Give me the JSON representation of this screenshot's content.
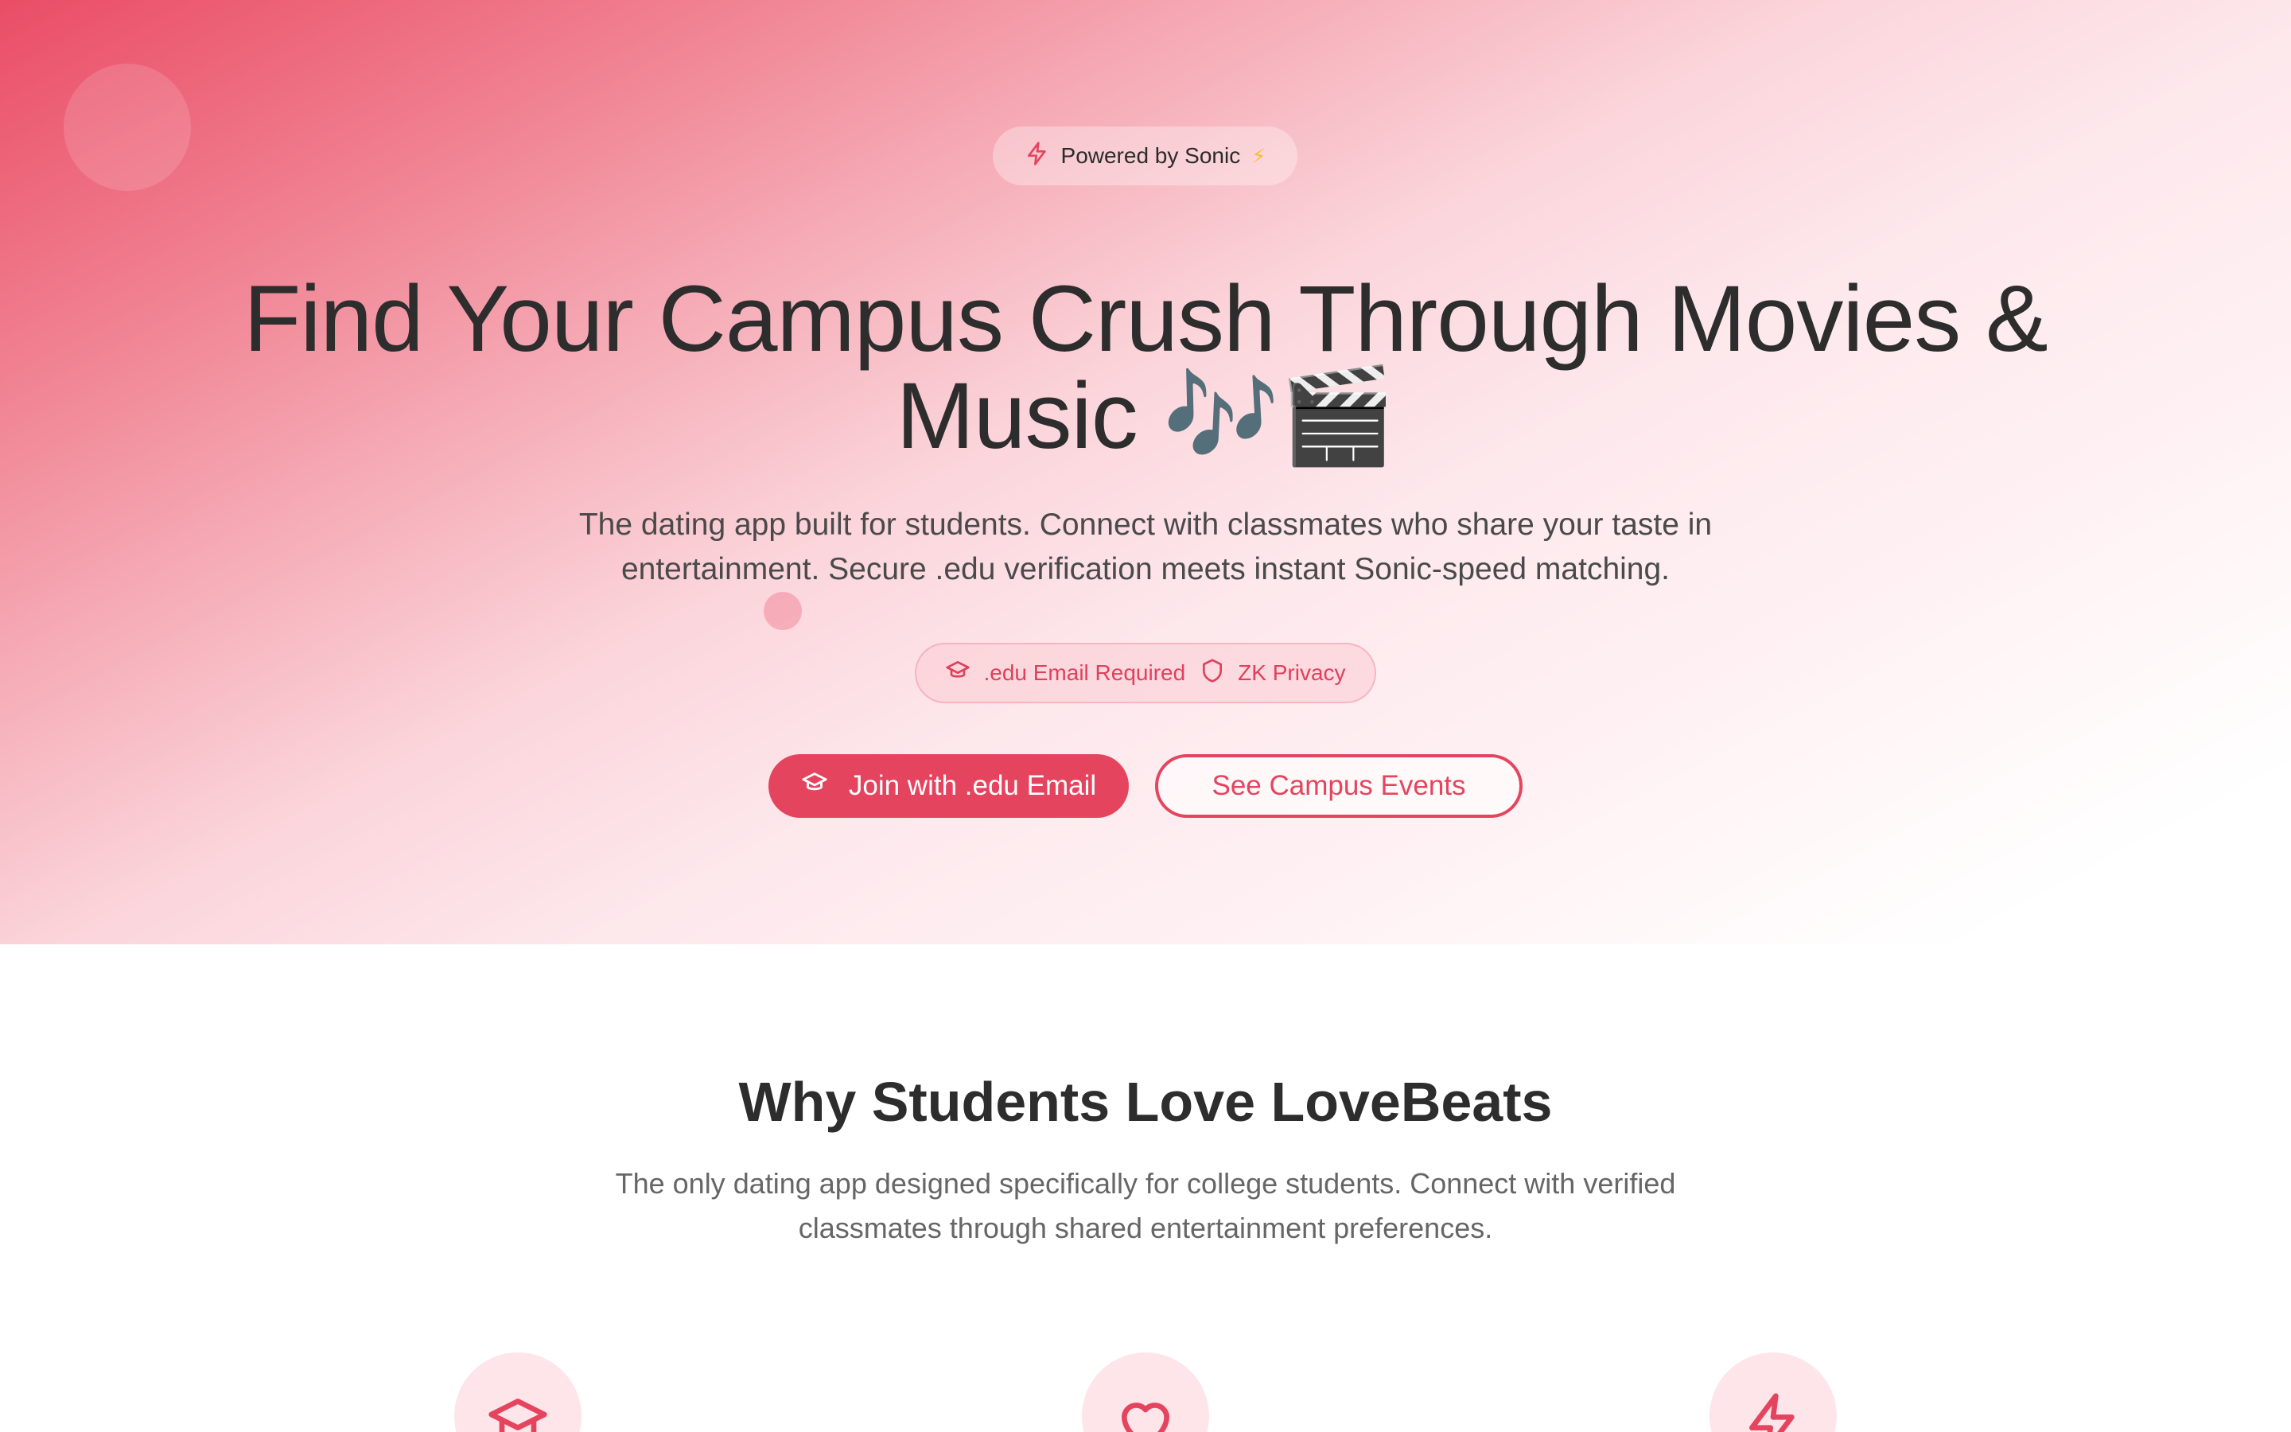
{
  "hero": {
    "powered_label": "Powered by Sonic",
    "powered_emoji": "⚡",
    "title_line1": "Find Your Campus Crush Through Movies &",
    "title_line2": "Music 🎶🎬",
    "subtitle": "The dating app built for students. Connect with classmates who share your taste in entertainment. Secure .edu verification meets instant Sonic-speed matching.",
    "badges": [
      {
        "icon": "graduation-cap-icon",
        "label": ".edu Email Required"
      },
      {
        "icon": "shield-icon",
        "label": "ZK Privacy"
      }
    ],
    "primary_cta": "Join with .edu Email",
    "secondary_cta": "See Campus Events"
  },
  "features": {
    "title": "Why Students Love LoveBeats",
    "subtitle": "The only dating app designed specifically for college students. Connect with verified classmates through shared entertainment preferences.",
    "icons": [
      "graduation-cap-icon",
      "heart-icon",
      "lightning-icon"
    ]
  },
  "colors": {
    "accent": "#e5445e",
    "hero_gradient_start": "#ea4d66",
    "badge_bg": "#fde5ea"
  }
}
